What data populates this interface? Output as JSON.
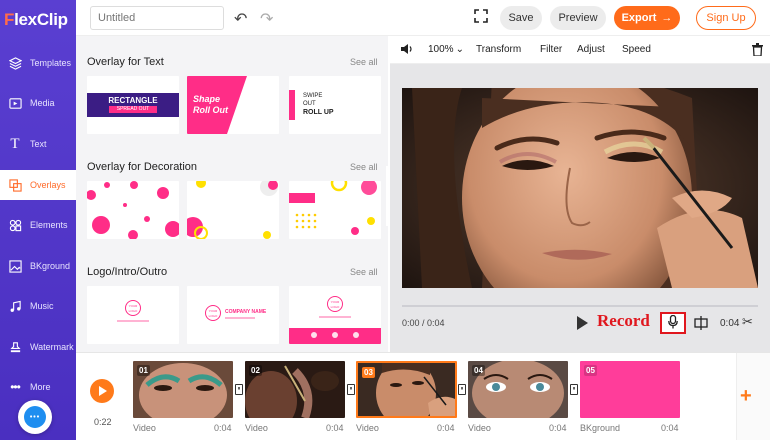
{
  "brand": {
    "logo_lead": "F",
    "logo_rest": "lexClip"
  },
  "sidebar": {
    "items": [
      {
        "id": "templates",
        "label": "Templates",
        "icon": "layers-icon"
      },
      {
        "id": "media",
        "label": "Media",
        "icon": "media-icon"
      },
      {
        "id": "text",
        "label": "Text",
        "icon": "text-icon"
      },
      {
        "id": "overlays",
        "label": "Overlays",
        "icon": "overlay-icon",
        "active": true
      },
      {
        "id": "elements",
        "label": "Elements",
        "icon": "elements-icon"
      },
      {
        "id": "bkground",
        "label": "BKground",
        "icon": "background-icon"
      },
      {
        "id": "music",
        "label": "Music",
        "icon": "music-icon"
      },
      {
        "id": "watermark",
        "label": "Watermark",
        "icon": "stamp-icon"
      },
      {
        "id": "more",
        "label": "More",
        "icon": "more-icon"
      }
    ],
    "chat_text": "•••"
  },
  "topbar": {
    "title_placeholder": "Untitled",
    "save": "Save",
    "preview": "Preview",
    "export": "Export",
    "signup": "Sign Up"
  },
  "panel": {
    "sections": [
      {
        "title": "Overlay for Text",
        "see_all": "See all"
      },
      {
        "title": "Overlay for Decoration",
        "see_all": "See all"
      },
      {
        "title": "Logo/Intro/Outro",
        "see_all": "See all"
      }
    ],
    "text_overlays": {
      "rectangle": "RECTANGLE",
      "rectangle_sub": "SPREAD OUT",
      "shape_line1": "Shape",
      "shape_line2": "Roll Out",
      "swipe_line1": "SWIPE",
      "swipe_line2": "OUT",
      "swipe_line3": "ROLL UP"
    },
    "logo_overlays": {
      "logo_text": "YOUR LOGO",
      "company": "COMPANY NAME"
    }
  },
  "preview": {
    "toolbar": {
      "zoom": "100%",
      "transform": "Transform",
      "filter": "Filter",
      "adjust": "Adjust",
      "speed": "Speed"
    },
    "current_time": "0:00 / 0:04",
    "record_label": "Record",
    "duration": "0:04"
  },
  "timeline": {
    "total_time": "0:22",
    "clips": [
      {
        "num": "01",
        "label": "Video",
        "dur": "0:04"
      },
      {
        "num": "02",
        "label": "Video",
        "dur": "0:04"
      },
      {
        "num": "03",
        "label": "Video",
        "dur": "0:04",
        "selected": true
      },
      {
        "num": "04",
        "label": "Video",
        "dur": "0:04"
      },
      {
        "num": "05",
        "label": "BKground",
        "dur": "0:04"
      }
    ]
  },
  "colors": {
    "sidebar": "#5a3fd1",
    "accent": "#ff6b1a",
    "pink": "#ff2d87",
    "record": "#e0171e"
  }
}
